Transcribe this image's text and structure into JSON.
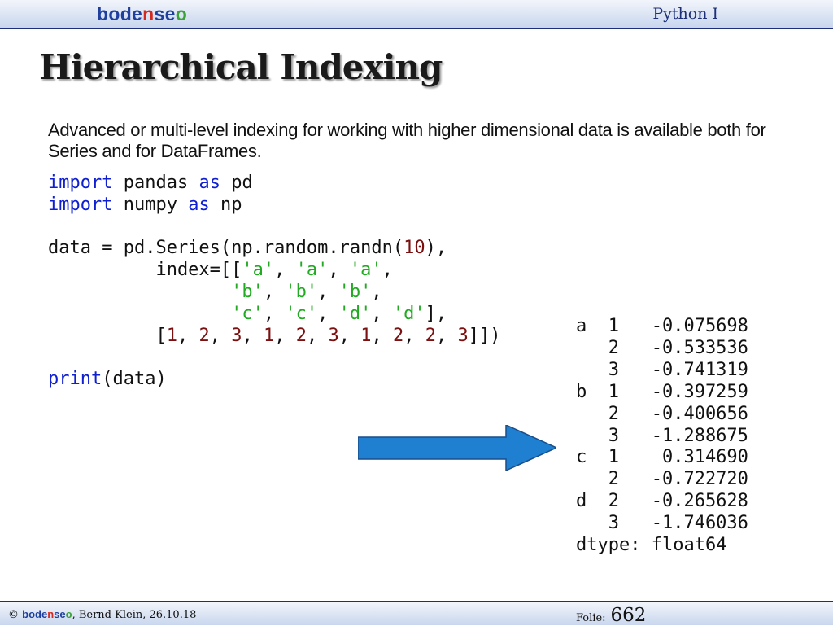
{
  "header": {
    "logo": {
      "part1": "bode",
      "part2": "n",
      "part3": "se",
      "part4": "o"
    },
    "course": "Python I"
  },
  "slide": {
    "title": "Hierarchical Indexing",
    "intro": "Advanced or multi-level indexing for working with higher dimensional data is available both for Series and for DataFrames."
  },
  "code_lines": [
    [
      {
        "t": "import",
        "c": "kw"
      },
      {
        "t": " pandas "
      },
      {
        "t": "as",
        "c": "kw"
      },
      {
        "t": " pd"
      }
    ],
    [
      {
        "t": "import",
        "c": "kw"
      },
      {
        "t": " numpy "
      },
      {
        "t": "as",
        "c": "kw"
      },
      {
        "t": " np"
      }
    ],
    [
      {
        "t": ""
      }
    ],
    [
      {
        "t": "data = pd.Series(np.random.randn("
      },
      {
        "t": "10",
        "c": "num"
      },
      {
        "t": "),"
      }
    ],
    [
      {
        "t": "          index=[["
      },
      {
        "t": "'a'",
        "c": "str"
      },
      {
        "t": ", "
      },
      {
        "t": "'a'",
        "c": "str"
      },
      {
        "t": ", "
      },
      {
        "t": "'a'",
        "c": "str"
      },
      {
        "t": ","
      }
    ],
    [
      {
        "t": "                 "
      },
      {
        "t": "'b'",
        "c": "str"
      },
      {
        "t": ", "
      },
      {
        "t": "'b'",
        "c": "str"
      },
      {
        "t": ", "
      },
      {
        "t": "'b'",
        "c": "str"
      },
      {
        "t": ","
      }
    ],
    [
      {
        "t": "                 "
      },
      {
        "t": "'c'",
        "c": "str"
      },
      {
        "t": ", "
      },
      {
        "t": "'c'",
        "c": "str"
      },
      {
        "t": ", "
      },
      {
        "t": "'d'",
        "c": "str"
      },
      {
        "t": ", "
      },
      {
        "t": "'d'",
        "c": "str"
      },
      {
        "t": "],"
      }
    ],
    [
      {
        "t": "          ["
      },
      {
        "t": "1",
        "c": "num"
      },
      {
        "t": ", "
      },
      {
        "t": "2",
        "c": "num"
      },
      {
        "t": ", "
      },
      {
        "t": "3",
        "c": "num"
      },
      {
        "t": ", "
      },
      {
        "t": "1",
        "c": "num"
      },
      {
        "t": ", "
      },
      {
        "t": "2",
        "c": "num"
      },
      {
        "t": ", "
      },
      {
        "t": "3",
        "c": "num"
      },
      {
        "t": ", "
      },
      {
        "t": "1",
        "c": "num"
      },
      {
        "t": ", "
      },
      {
        "t": "2",
        "c": "num"
      },
      {
        "t": ", "
      },
      {
        "t": "2",
        "c": "num"
      },
      {
        "t": ", "
      },
      {
        "t": "3",
        "c": "num"
      },
      {
        "t": "]])"
      }
    ],
    [
      {
        "t": ""
      }
    ],
    [
      {
        "t": "print",
        "c": "kw"
      },
      {
        "t": "(data)"
      }
    ]
  ],
  "output_lines": [
    "a  1   -0.075698",
    "   2   -0.533536",
    "   3   -0.741319",
    "b  1   -0.397259",
    "   2   -0.400656",
    "   3   -1.288675",
    "c  1    0.314690",
    "   2   -0.722720",
    "d  2   -0.265628",
    "   3   -1.746036",
    "dtype: float64"
  ],
  "footer": {
    "copyright_symbol": "©",
    "logo": {
      "part1": "bode",
      "part2": "n",
      "part3": "se",
      "part4": "o"
    },
    "author_date": ", Bernd Klein, 26.10.18",
    "folie_label": "Folie:",
    "folie_number": "662"
  },
  "colors": {
    "keyword": "#1020d0",
    "string": "#22aa22",
    "number": "#7a1010",
    "arrow": "#1f7fd0",
    "bar_border": "#1c2f78"
  }
}
